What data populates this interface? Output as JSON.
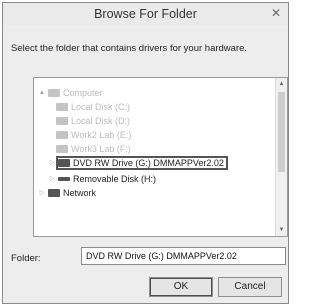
{
  "dialog": {
    "title": "Browse For Folder",
    "close": "✕",
    "instruction": "Select the folder that contains drivers for your hardware.",
    "tree": [
      {
        "label": "Computer",
        "arrow": "▲"
      },
      {
        "label": "Local Disk (C:)",
        "arrow": ""
      },
      {
        "label": "Local Disk (D:)",
        "arrow": ""
      },
      {
        "label": "Work2 Lab (E:)",
        "arrow": ""
      },
      {
        "label": "Work3 Lab (F:)",
        "arrow": ""
      },
      {
        "label": "DVD RW Drive (G:) DMMAPPVer2.02",
        "arrow": "▷"
      },
      {
        "label": "Removable Disk (H:)",
        "arrow": "▷"
      },
      {
        "label": "Network",
        "arrow": "▷"
      }
    ],
    "scroll_up": "▲",
    "scroll_down": "▼",
    "folder_label": "Folder:",
    "folder_value": "DVD RW Drive (G:) DMMAPPVer2.02",
    "ok": "OK",
    "cancel": "Cancel"
  }
}
